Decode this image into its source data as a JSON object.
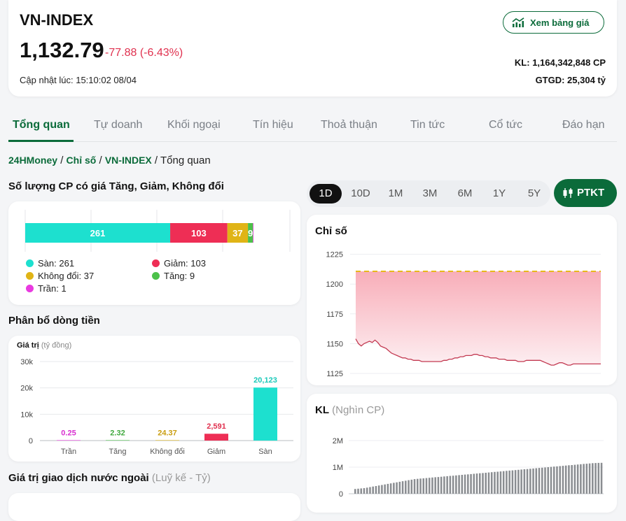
{
  "header": {
    "title": "VN-INDEX",
    "price": "1,132.79",
    "change": "-77.88 (-6.43%)",
    "updated": "Cập nhật lúc: 15:10:02 08/04",
    "price_board_button": "Xem bảng giá",
    "volume": "KL: 1,164,342,848 CP",
    "value": "GTGD: 25,304 tỷ"
  },
  "tabs": [
    "Tổng quan",
    "Tự doanh",
    "Khối ngoại",
    "Tín hiệu",
    "Thoả thuận",
    "Tin tức",
    "Cổ tức",
    "Đáo hạn"
  ],
  "breadcrumb": {
    "home": "24HMoney",
    "sep": " / ",
    "section": "Chỉ số",
    "index": "VN-INDEX",
    "current": "Tổng quan"
  },
  "colors": {
    "green": "#0b6b3a",
    "floor": "#1de0cf",
    "down": "#ee2e55",
    "flat": "#e0b416",
    "up": "#4cc14a",
    "ceiling": "#e93ae0"
  },
  "breadth": {
    "title": "Số lượng CP có giá Tăng, Giảm, Không đổi",
    "legend": {
      "floor": "Sàn: 261",
      "down": "Giảm: 103",
      "flat": "Không đổi: 37",
      "up": "Tăng: 9",
      "ceiling": "Trần: 1"
    }
  },
  "flow": {
    "title": "Phân bổ dòng tiền",
    "value_label": "Giá trị",
    "unit": "(tỷ đồng)"
  },
  "foreign": {
    "title": "Giá trị giao dịch nước ngoài",
    "subtitle": "(Luỹ kế - Tỷ)"
  },
  "ranges": [
    "1D",
    "10D",
    "1M",
    "3M",
    "6M",
    "1Y",
    "5Y"
  ],
  "ptkt_button": "PTKT",
  "index_chart": {
    "title": "Chỉ số"
  },
  "volume_chart": {
    "title": "KL",
    "unit": "(Nghìn CP)"
  },
  "chart_data": [
    {
      "type": "bar",
      "orientation": "horizontal-stacked",
      "categories": [
        "Sàn",
        "Giảm",
        "Không đổi",
        "Tăng",
        "Trần"
      ],
      "values": [
        261,
        103,
        37,
        9,
        1
      ],
      "data_labels": [
        "261",
        "103",
        "37",
        "9",
        ""
      ]
    },
    {
      "type": "bar",
      "categories": [
        "Trần",
        "Tăng",
        "Không đổi",
        "Giảm",
        "Sàn"
      ],
      "values": [
        0.25,
        2.32,
        24.37,
        2591,
        20123
      ],
      "data_labels": [
        "0.25",
        "2.32",
        "24.37",
        "2,591",
        "20,123"
      ],
      "ylabel": "Giá trị",
      "ylim": [
        0,
        30000
      ],
      "yticks": [
        "0",
        "10k",
        "20k",
        "30k"
      ],
      "grid": true
    },
    {
      "type": "area",
      "title": "Chỉ số",
      "yticks": [
        1125,
        1150,
        1175,
        1200,
        1225
      ],
      "ylim": [
        1120,
        1230
      ],
      "reference": 1210.67,
      "values": [
        1154,
        1150,
        1148,
        1150,
        1151,
        1152,
        1151,
        1153,
        1151,
        1148,
        1147,
        1146,
        1144,
        1142,
        1141,
        1140,
        1139,
        1138,
        1138,
        1137,
        1137,
        1136,
        1136,
        1136,
        1135,
        1135,
        1135,
        1135,
        1135,
        1135,
        1135,
        1135,
        1136,
        1136,
        1137,
        1137,
        1138,
        1138,
        1139,
        1139,
        1140,
        1140,
        1140,
        1141,
        1141,
        1140,
        1140,
        1139,
        1139,
        1138,
        1138,
        1138,
        1137,
        1137,
        1137,
        1136,
        1136,
        1136,
        1136,
        1135,
        1135,
        1135,
        1136,
        1136,
        1136,
        1136,
        1136,
        1136,
        1135,
        1134,
        1133,
        1132,
        1132,
        1133,
        1134,
        1134,
        1133,
        1132,
        1132,
        1133,
        1133,
        1133,
        1133,
        1133,
        1133,
        1133,
        1133,
        1133,
        1133,
        1133
      ]
    },
    {
      "type": "bar",
      "title": "KL",
      "yticks": [
        "0",
        "1M",
        "2M"
      ],
      "ylim": [
        0,
        2200000
      ],
      "values": [
        180000,
        190000,
        200000,
        210000,
        230000,
        250000,
        270000,
        290000,
        310000,
        330000,
        350000,
        370000,
        390000,
        410000,
        430000,
        450000,
        470000,
        490000,
        510000,
        530000,
        550000,
        560000,
        570000,
        580000,
        590000,
        600000,
        610000,
        620000,
        630000,
        640000,
        650000,
        660000,
        670000,
        680000,
        690000,
        700000,
        710000,
        720000,
        730000,
        740000,
        750000,
        760000,
        770000,
        780000,
        790000,
        800000,
        810000,
        820000,
        830000,
        840000,
        850000,
        860000,
        870000,
        880000,
        890000,
        900000,
        910000,
        920000,
        930000,
        940000,
        950000,
        960000,
        970000,
        980000,
        990000,
        1000000,
        1010000,
        1020000,
        1030000,
        1040000,
        1050000,
        1060000,
        1070000,
        1080000,
        1090000,
        1100000,
        1110000,
        1120000,
        1130000,
        1140000,
        1150000,
        1155000,
        1160000,
        1164342
      ]
    }
  ]
}
